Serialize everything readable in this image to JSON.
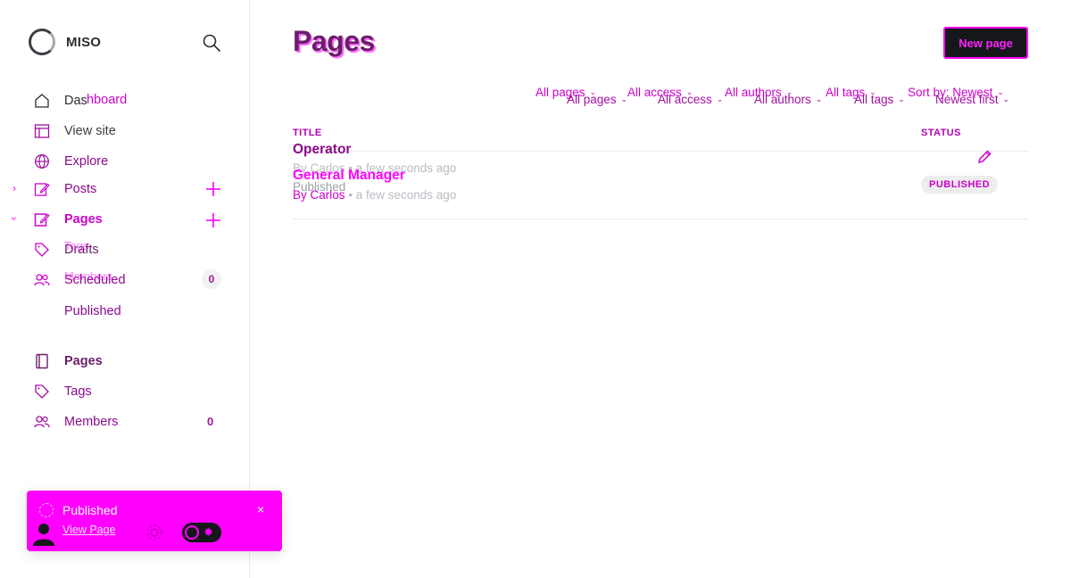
{
  "brand": {
    "name": "MISO"
  },
  "sidebar": {
    "items": [
      {
        "id": "dashboard",
        "label": "Dashboard",
        "ghost": "hboard"
      },
      {
        "id": "view-site",
        "label": "View site"
      },
      {
        "id": "explore",
        "label": "Explore"
      },
      {
        "id": "posts",
        "label": "Posts"
      },
      {
        "id": "pages",
        "label": "Pages"
      },
      {
        "id": "drafts",
        "label": "Drafts",
        "ghost": "Tags"
      },
      {
        "id": "scheduled",
        "label": "Scheduled",
        "ghost": "Members",
        "count": "0"
      },
      {
        "id": "published",
        "label": "Published"
      },
      {
        "id": "pages-2",
        "label": "Pages"
      },
      {
        "id": "tags",
        "label": "Tags"
      },
      {
        "id": "members",
        "label": "Members",
        "count": "0"
      }
    ]
  },
  "main": {
    "title": "Pages",
    "new_button": "New page",
    "filters_back": [
      "All pages",
      "All access",
      "All authors",
      "All tags",
      "Sort by: Newest"
    ],
    "filters_front": [
      "All pages",
      "All access",
      "All authors",
      "All tags",
      "Newest first"
    ],
    "columns": {
      "title": "TITLE",
      "status": "STATUS"
    },
    "rows": [
      {
        "title": "Operator",
        "meta": "By Carlos • a few seconds ago"
      },
      {
        "title": "General Manager",
        "status_line": "Published",
        "meta_author": "By Carlos",
        "meta_time": " • a few seconds ago",
        "status": "PUBLISHED"
      }
    ]
  },
  "toast": {
    "title": "Published",
    "link": "View Page",
    "close": "×"
  },
  "colors": {
    "accent": "#ff00ff",
    "dark": "#15171a"
  }
}
